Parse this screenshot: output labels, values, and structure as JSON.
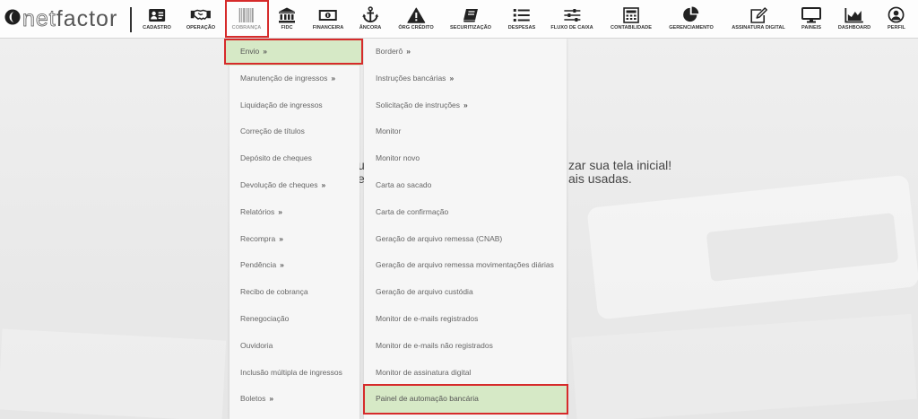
{
  "logo": {
    "icon": "netfactor-logo-icon",
    "text_light": "net",
    "text_dark": "factor"
  },
  "toolbar": {
    "items": [
      {
        "label": "CADASTRO",
        "icon": "id-card-icon"
      },
      {
        "label": "OPERAÇÃO",
        "icon": "handshake-icon"
      },
      {
        "label": "COBRANÇA",
        "icon": "barcode-icon",
        "active": true
      },
      {
        "label": "FIDC",
        "icon": "bank-icon"
      },
      {
        "label": "FINANCEIRA",
        "icon": "money-bill-icon"
      },
      {
        "label": "ÂNCORA",
        "icon": "anchor-icon"
      },
      {
        "label": "ÓRG CRÉDITO",
        "icon": "warning-triangle-icon"
      },
      {
        "label": "SECURITIZAÇÃO",
        "icon": "book-icon"
      },
      {
        "label": "DESPESAS",
        "icon": "list-icon"
      },
      {
        "label": "FLUXO DE CAIXA",
        "icon": "sliders-icon"
      },
      {
        "label": "CONTABILIDADE",
        "icon": "calculator-icon"
      },
      {
        "label": "GERENCIAMENTO",
        "icon": "pie-chart-icon"
      },
      {
        "label": "ASSINATURA DIGITAL",
        "icon": "edit-square-icon"
      },
      {
        "label": "PAINEIS",
        "icon": "desktop-icon"
      },
      {
        "label": "DASHBOARD",
        "icon": "area-chart-icon"
      },
      {
        "label": "PERFIL",
        "icon": "user-circle-icon"
      }
    ]
  },
  "menus": {
    "submenu_indicator": "»",
    "cobranca": {
      "items": [
        {
          "label": "Envio",
          "has_submenu": true,
          "highlighted": true
        },
        {
          "label": "Manutenção de ingressos",
          "has_submenu": true
        },
        {
          "label": "Liquidação de ingressos",
          "has_submenu": false
        },
        {
          "label": "Correção de títulos",
          "has_submenu": false
        },
        {
          "label": "Depósito de cheques",
          "has_submenu": false
        },
        {
          "label": "Devolução de cheques",
          "has_submenu": true
        },
        {
          "label": "Relatórios",
          "has_submenu": true
        },
        {
          "label": "Recompra",
          "has_submenu": true
        },
        {
          "label": "Pendência",
          "has_submenu": true
        },
        {
          "label": "Recibo de cobrança",
          "has_submenu": false
        },
        {
          "label": "Renegociação",
          "has_submenu": false
        },
        {
          "label": "Ouvidoria",
          "has_submenu": false
        },
        {
          "label": "Inclusão múltipla de ingressos",
          "has_submenu": false
        },
        {
          "label": "Boletos",
          "has_submenu": true
        }
      ]
    },
    "envio": {
      "items": [
        {
          "label": "Borderô",
          "has_submenu": true
        },
        {
          "label": "Instruções bancárias",
          "has_submenu": true
        },
        {
          "label": "Solicitação de instruções",
          "has_submenu": true
        },
        {
          "label": "Monitor",
          "has_submenu": false
        },
        {
          "label": "Monitor novo",
          "has_submenu": false
        },
        {
          "label": "Carta ao sacado",
          "has_submenu": false
        },
        {
          "label": "Carta de confirmação",
          "has_submenu": false
        },
        {
          "label": "Geração de arquivo remessa (CNAB)",
          "has_submenu": false
        },
        {
          "label": "Geração de arquivo remessa movimentações diárias",
          "has_submenu": false
        },
        {
          "label": "Geração de arquivo custódia",
          "has_submenu": false
        },
        {
          "label": "Monitor de e-mails registrados",
          "has_submenu": false
        },
        {
          "label": "Monitor de e-mails não registrados",
          "has_submenu": false
        },
        {
          "label": "Monitor de assinatura digital",
          "has_submenu": false
        },
        {
          "label": "Painel de automação bancária",
          "has_submenu": false,
          "highlighted": true
        }
      ]
    }
  },
  "background_message": {
    "line1_start": "u",
    "line1_end": "zar sua tela inicial!",
    "line2_start": "e",
    "line2_end": "ais usadas."
  },
  "colors": {
    "highlight_green": "#d6e9c6",
    "annotation_red": "#d62b2b",
    "menu_text": "#666666",
    "header_bg": "#fdfdfd",
    "page_bg": "#ebebeb"
  }
}
